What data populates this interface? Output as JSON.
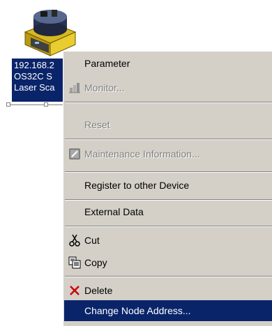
{
  "device": {
    "label_lines": [
      "192.168.2",
      "OS32C S",
      "Laser Sca"
    ]
  },
  "context_menu": {
    "items": [
      {
        "label": "Parameter",
        "enabled": true,
        "submenu": true,
        "icon": ""
      },
      {
        "label": "Monitor...",
        "enabled": false,
        "submenu": false,
        "icon": "monitor-icon"
      },
      {
        "label": "Reset",
        "enabled": false,
        "submenu": false,
        "icon": ""
      },
      {
        "label": "Maintenance Information...",
        "enabled": false,
        "submenu": false,
        "icon": "maintenance-icon"
      },
      {
        "label": "Register to other Device",
        "enabled": true,
        "submenu": true,
        "icon": ""
      },
      {
        "label": "External Data",
        "enabled": true,
        "submenu": true,
        "icon": ""
      },
      {
        "label": "Cut",
        "enabled": true,
        "submenu": false,
        "icon": "scissors-icon"
      },
      {
        "label": "Copy",
        "enabled": true,
        "submenu": false,
        "icon": "copy-icon"
      },
      {
        "label": "Delete",
        "enabled": true,
        "submenu": false,
        "icon": "delete-x-icon"
      },
      {
        "label": "Change Node Address...",
        "enabled": true,
        "submenu": false,
        "icon": "",
        "highlighted": true
      }
    ]
  },
  "colors": {
    "menu_bg": "#d4d0c8",
    "highlight_bg": "#0a246a",
    "delete_icon": "#cc0000",
    "device_body": "#e0c020"
  }
}
